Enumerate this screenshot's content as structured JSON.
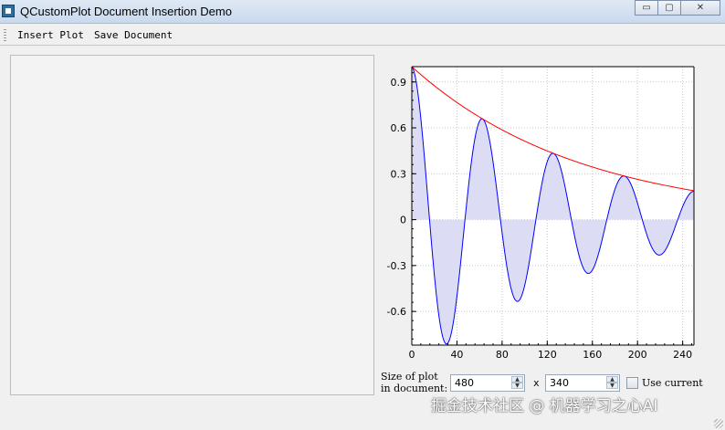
{
  "window": {
    "title": "QCustomPlot Document Insertion Demo",
    "controls": {
      "minimize": "▭",
      "maximize": "▢",
      "close": "✕"
    }
  },
  "toolbar": {
    "insert_plot_label": "Insert Plot",
    "save_document_label": "Save Document"
  },
  "editor": {
    "text": ""
  },
  "plot": {
    "x_ticks": [
      "0",
      "40",
      "80",
      "120",
      "160",
      "200",
      "240"
    ],
    "y_ticks": [
      "0.9",
      "0.6",
      "0.3",
      "0",
      "-0.3",
      "-0.6"
    ]
  },
  "size_controls": {
    "label": "Size of plot\nin document:",
    "width_value": "480",
    "times": "x",
    "height_value": "340",
    "use_current_label": "Use current",
    "use_current_checked": false
  },
  "watermark": "掘金技术社区 @ 机器学习之心AI",
  "chart_data": {
    "type": "line",
    "x_range": [
      0,
      250
    ],
    "y_range": [
      -0.82,
      1.0
    ],
    "grid": true,
    "series": [
      {
        "color": "#0000ff",
        "fill": "#dcdcf5",
        "formula": "exp(-x/150)*cos(x/10)",
        "x": [
          0,
          31.4,
          62.8,
          94.2,
          125.7,
          157.1,
          188.5,
          219.9,
          250
        ],
        "values": [
          1.0,
          -0.81,
          0.66,
          -0.53,
          0.43,
          -0.35,
          0.28,
          -0.23,
          0.19
        ]
      },
      {
        "color": "#ff0000",
        "formula": "exp(-x/150)",
        "x": [
          0,
          50,
          100,
          150,
          200,
          250
        ],
        "values": [
          1.0,
          0.72,
          0.51,
          0.37,
          0.26,
          0.19
        ]
      }
    ]
  }
}
